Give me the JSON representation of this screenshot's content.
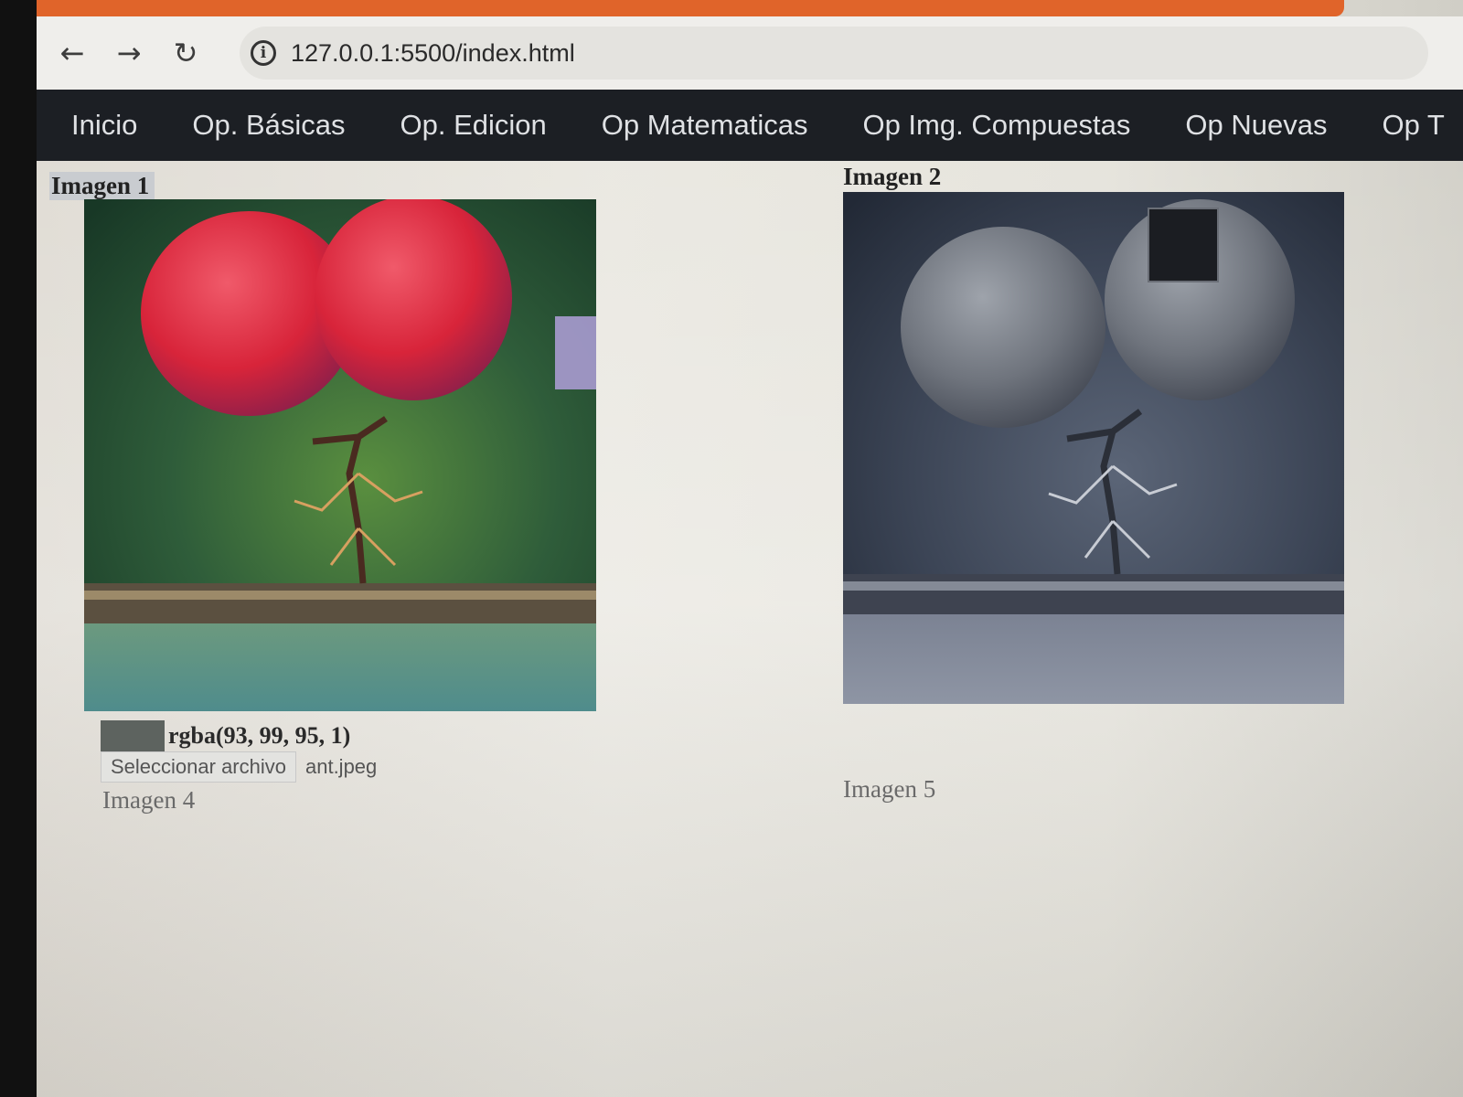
{
  "browser": {
    "url": "127.0.0.1:5500/index.html",
    "back_icon": "arrow-left-icon",
    "forward_icon": "arrow-right-icon",
    "reload_icon": "reload-icon",
    "info_icon": "info-icon"
  },
  "nav": {
    "items": [
      {
        "label": "Inicio"
      },
      {
        "label": "Op. Básicas"
      },
      {
        "label": "Op. Edicion"
      },
      {
        "label": "Op Matematicas"
      },
      {
        "label": "Op Img. Compuestas"
      },
      {
        "label": "Op Nuevas"
      },
      {
        "label": "Op T"
      }
    ]
  },
  "images": {
    "image1": {
      "label": "Imagen 1"
    },
    "image2": {
      "label": "Imagen 2"
    },
    "image4": {
      "label": "Imagen 4"
    },
    "image5": {
      "label": "Imagen 5"
    }
  },
  "pixel": {
    "text": "rgba(93, 99, 95, 1)",
    "color": "#5d635f"
  },
  "file_input": {
    "button_label": "Seleccionar archivo",
    "file_name": "ant.jpeg"
  }
}
